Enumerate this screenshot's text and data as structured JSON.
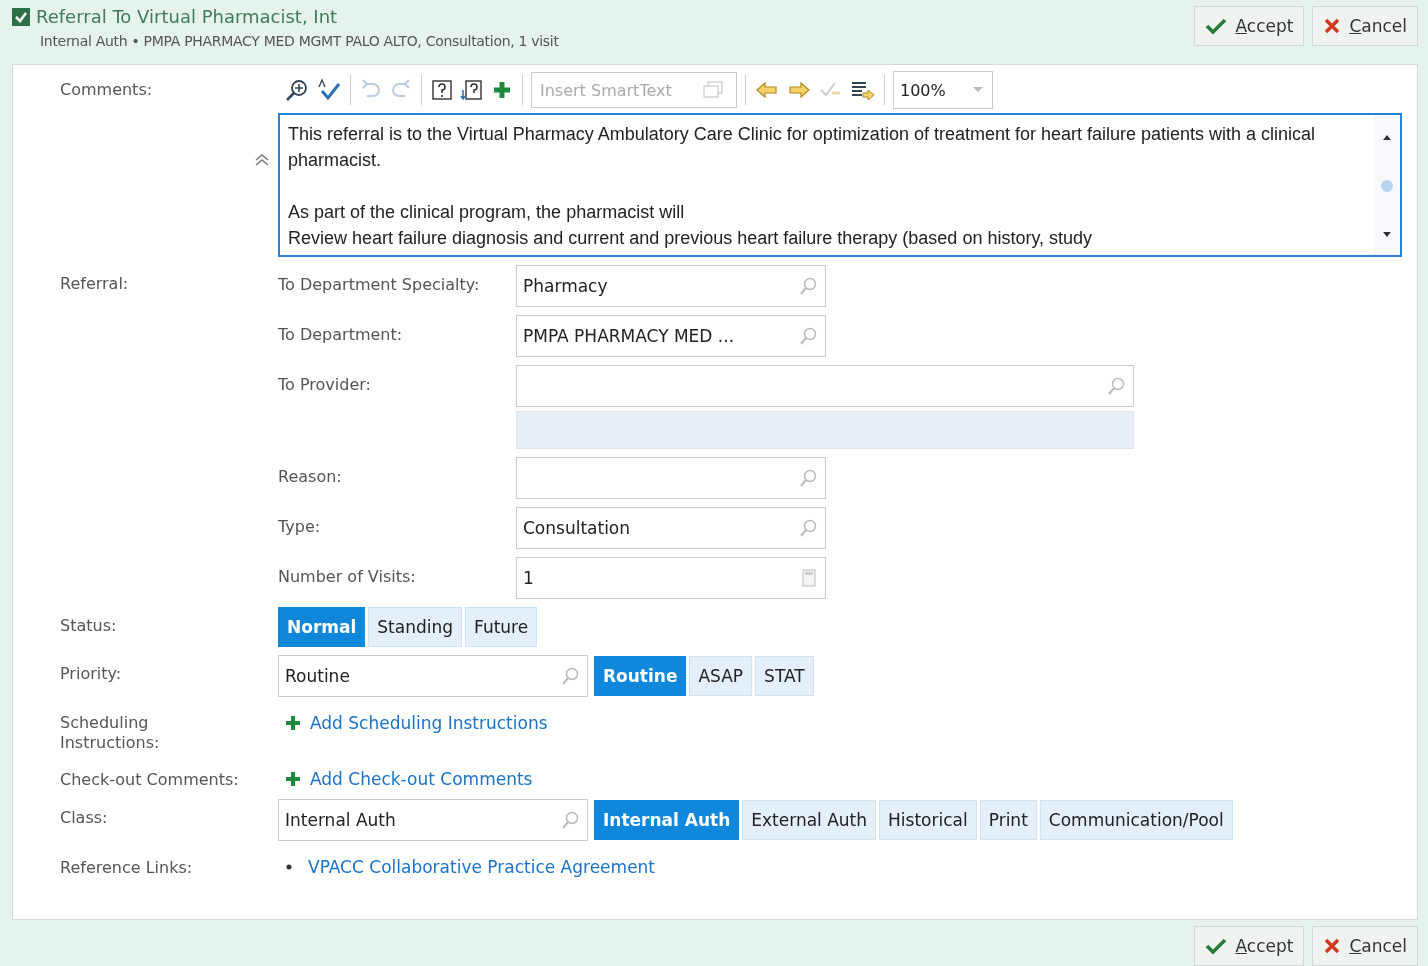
{
  "header": {
    "checked": true,
    "title": "Referral To Virtual Pharmacist, Int",
    "subtitle": "Internal Auth • PMPA PHARMACY MED MGMT PALO ALTO, Consultation, 1 visit"
  },
  "top_buttons": [
    {
      "label": "Accept",
      "kind": "accept"
    },
    {
      "label": "Cancel",
      "kind": "cancel"
    }
  ],
  "comments": {
    "label": "Comments:",
    "smarttext_placeholder": "Insert SmartText",
    "zoom": "100%",
    "text": "This referral is to the Virtual Pharmacy Ambulatory Care Clinic for optimization of treatment for heart failure patients with a clinical pharmacist.\n\nAs part of the clinical program, the pharmacist will\nReview heart failure diagnosis and current and previous heart failure therapy (based on history, study"
  },
  "referral": {
    "label": "Referral:",
    "fields": [
      {
        "label": "To Department Specialty:",
        "value": "Pharmacy",
        "kind": "lookup"
      },
      {
        "label": "To Department:",
        "value": "PMPA PHARMACY MED ...",
        "kind": "lookup"
      },
      {
        "label": "To Provider:",
        "kind": "wide"
      },
      {
        "label": "Reason:",
        "kind": "lookup"
      },
      {
        "label": "Type:",
        "value": "Consultation",
        "kind": "lookup"
      },
      {
        "label": "Number of Visits:",
        "value": "1",
        "kind": "number"
      }
    ]
  },
  "status": {
    "label": "Status:",
    "options": [
      {
        "label": "Normal",
        "selected": true
      },
      {
        "label": "Standing",
        "selected": false
      },
      {
        "label": "Future",
        "selected": false
      }
    ]
  },
  "priority": {
    "label": "Priority:",
    "value": "Routine",
    "options": [
      {
        "label": "Routine",
        "selected": true
      },
      {
        "label": "ASAP",
        "selected": false
      },
      {
        "label": "STAT",
        "selected": false
      }
    ]
  },
  "scheduling": {
    "label": "Scheduling Instructions:",
    "link": "Add Scheduling Instructions"
  },
  "checkout": {
    "label": "Check-out Comments:",
    "link": "Add Check-out Comments"
  },
  "class": {
    "label": "Class:",
    "value": "Internal Auth",
    "options": [
      {
        "label": "Internal Auth",
        "selected": true
      },
      {
        "label": "External Auth",
        "selected": false
      },
      {
        "label": "Historical",
        "selected": false
      },
      {
        "label": "Print",
        "selected": false
      },
      {
        "label": "Communication/Pool",
        "selected": false
      }
    ]
  },
  "reference_links": {
    "label": "Reference Links:",
    "links": [
      "VPACC Collaborative Practice Agreement"
    ]
  },
  "bottom_buttons": [
    {
      "label": "Accept",
      "kind": "accept"
    },
    {
      "label": "Cancel",
      "kind": "cancel"
    }
  ]
}
